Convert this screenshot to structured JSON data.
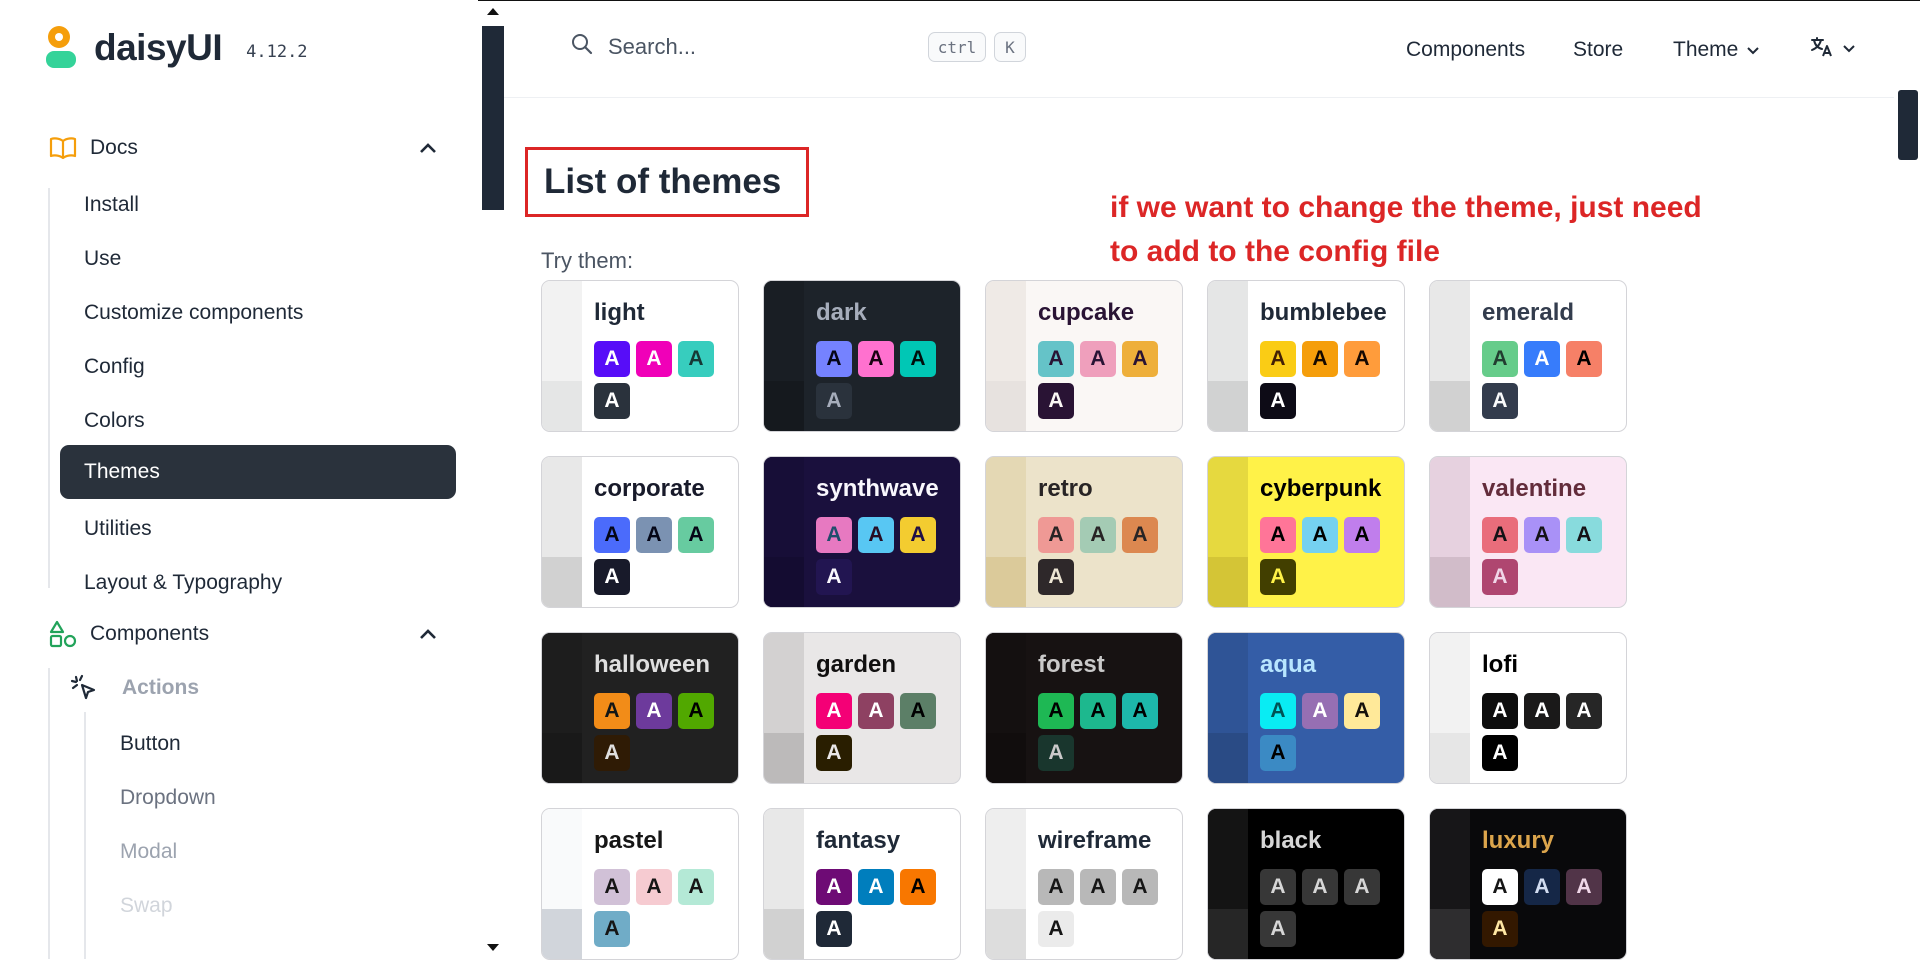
{
  "brand": {
    "name": "daisyUI",
    "version": "4.12.2"
  },
  "search": {
    "placeholder": "Search...",
    "kbd1": "ctrl",
    "kbd2": "K"
  },
  "topnav": {
    "components": "Components",
    "store": "Store",
    "theme": "Theme"
  },
  "sidebar": {
    "docs_label": "Docs",
    "docs_items": [
      "Install",
      "Use",
      "Customize components",
      "Config",
      "Colors",
      "Themes",
      "Utilities",
      "Layout & Typography"
    ],
    "active_item": "Themes",
    "components_label": "Components",
    "actions_label": "Actions",
    "actions_items": [
      "Button",
      "Dropdown",
      "Modal",
      "Swap"
    ]
  },
  "main": {
    "title": "List of themes",
    "annotation": "if we want to change the theme, just need to add to the config file",
    "try_label": "Try them:",
    "swatch_letter": "A",
    "themes": [
      {
        "name": "light",
        "bg": "#ffffff",
        "side": "#f2f2f2",
        "side2": "#e5e6e6",
        "text": "#1f2937",
        "sw": [
          [
            "#570df8",
            "#ffffff"
          ],
          [
            "#f000b8",
            "#ffffff"
          ],
          [
            "#37cdbe",
            "#163835"
          ],
          [
            "#2a323c",
            "#ffffff"
          ]
        ]
      },
      {
        "name": "dark",
        "bg": "#1d232a",
        "side": "#191e24",
        "side2": "#15191e",
        "text": "#a6adbb",
        "sw": [
          [
            "#7582ff",
            "#050617"
          ],
          [
            "#ff71cf",
            "#190211"
          ],
          [
            "#00c7b5",
            "#000e0c"
          ],
          [
            "#2a323c",
            "#a6adbb"
          ]
        ]
      },
      {
        "name": "cupcake",
        "bg": "#faf7f5",
        "side": "#efeae6",
        "side2": "#e7e2df",
        "text": "#291334",
        "sw": [
          [
            "#65c3c8",
            "#291334"
          ],
          [
            "#ef9fbc",
            "#291334"
          ],
          [
            "#eeaf3a",
            "#291334"
          ],
          [
            "#291334",
            "#faf7f5"
          ]
        ]
      },
      {
        "name": "bumblebee",
        "bg": "#ffffff",
        "side": "#e5e6e6",
        "side2": "#d1d2d2",
        "text": "#1f2937",
        "sw": [
          [
            "#facc15",
            "#422006"
          ],
          [
            "#f59e0b",
            "#150a00"
          ],
          [
            "#ff9c3b",
            "#160902"
          ],
          [
            "#0d0b16",
            "#ffffff"
          ]
        ]
      },
      {
        "name": "emerald",
        "bg": "#ffffff",
        "side": "#e8e8e8",
        "side2": "#d1d1d1",
        "text": "#333c4d",
        "sw": [
          [
            "#66cc8a",
            "#223d30"
          ],
          [
            "#377cfb",
            "#ffffff"
          ],
          [
            "#f68067",
            "#000000"
          ],
          [
            "#333c4d",
            "#f9fafb"
          ]
        ]
      },
      {
        "name": "corporate",
        "bg": "#ffffff",
        "side": "#e8e8e8",
        "side2": "#d1d1d1",
        "text": "#181a2a",
        "sw": [
          [
            "#4b6bfb",
            "#050617"
          ],
          [
            "#7b92b2",
            "#050617"
          ],
          [
            "#67cba0",
            "#050617"
          ],
          [
            "#181a2a",
            "#ffffff"
          ]
        ]
      },
      {
        "name": "synthwave",
        "bg": "#1a103d",
        "side": "#170e37",
        "side2": "#140c31",
        "text": "#f9f7fd",
        "sw": [
          [
            "#e779c1",
            "#204e6c"
          ],
          [
            "#58c7f3",
            "#270d24"
          ],
          [
            "#f3cc30",
            "#201047"
          ],
          [
            "#221551",
            "#f9f7fd"
          ]
        ]
      },
      {
        "name": "retro",
        "bg": "#ece3ca",
        "side": "#e4d8b4",
        "side2": "#dbca9a",
        "text": "#282425",
        "sw": [
          [
            "#ef9995",
            "#282425"
          ],
          [
            "#a4cbb4",
            "#282425"
          ],
          [
            "#dc8850",
            "#282425"
          ],
          [
            "#2e282a",
            "#ede6d4"
          ]
        ]
      },
      {
        "name": "cyberpunk",
        "bg": "#fff248",
        "side": "#e6d93f",
        "side2": "#d4c536",
        "text": "#000000",
        "sw": [
          [
            "#ff7598",
            "#000000"
          ],
          [
            "#75d1f0",
            "#000000"
          ],
          [
            "#c07eec",
            "#000000"
          ],
          [
            "#423f00",
            "#fff248"
          ]
        ]
      },
      {
        "name": "valentine",
        "bg": "#fae7f4",
        "side": "#e6d1df",
        "side2": "#d1bcc9",
        "text": "#632c3b",
        "sw": [
          [
            "#e96d7b",
            "#151216"
          ],
          [
            "#a991f7",
            "#151216"
          ],
          [
            "#88dbdd",
            "#151216"
          ],
          [
            "#af4670",
            "#f0d6e8"
          ]
        ]
      },
      {
        "name": "halloween",
        "bg": "#212121",
        "side": "#1d1d1d",
        "side2": "#191919",
        "text": "#dfdfdf",
        "sw": [
          [
            "#f28c18",
            "#131616"
          ],
          [
            "#6d3a9c",
            "#ffffff"
          ],
          [
            "#51a800",
            "#000000"
          ],
          [
            "#2f1b05",
            "#dfdfdf"
          ]
        ]
      },
      {
        "name": "garden",
        "bg": "#e9e7e7",
        "side": "#d3d1d1",
        "side2": "#bcbaba",
        "text": "#100f0f",
        "sw": [
          [
            "#f40076",
            "#ffffff"
          ],
          [
            "#8e4162",
            "#ffffff"
          ],
          [
            "#5c7f67",
            "#000000"
          ],
          [
            "#291e00",
            "#e9e7e7"
          ]
        ]
      },
      {
        "name": "forest",
        "bg": "#171212",
        "side": "#141010",
        "side2": "#110d0d",
        "text": "#cac9c9",
        "sw": [
          [
            "#1eb854",
            "#000000"
          ],
          [
            "#1db88e",
            "#000000"
          ],
          [
            "#1db8ab",
            "#000000"
          ],
          [
            "#19362d",
            "#cac9c9"
          ]
        ]
      },
      {
        "name": "aqua",
        "bg": "#345da7",
        "side": "#2f5496",
        "side2": "#2a4b85",
        "text": "#b8e6ff",
        "sw": [
          [
            "#09ecf3",
            "#005355"
          ],
          [
            "#966fb3",
            "#ffffff"
          ],
          [
            "#ffe999",
            "#16120c"
          ],
          [
            "#3b8ac4",
            "#000000"
          ]
        ]
      },
      {
        "name": "lofi",
        "bg": "#ffffff",
        "side": "#f2f2f2",
        "side2": "#e6e6e6",
        "text": "#000000",
        "sw": [
          [
            "#0d0d0d",
            "#ffffff"
          ],
          [
            "#1a1919",
            "#ffffff"
          ],
          [
            "#262626",
            "#ffffff"
          ],
          [
            "#000000",
            "#ffffff"
          ]
        ]
      },
      {
        "name": "pastel",
        "bg": "#ffffff",
        "side": "#f9fafb",
        "side2": "#d1d5db",
        "text": "#161616",
        "sw": [
          [
            "#d1c1d7",
            "#161616"
          ],
          [
            "#f6cbd1",
            "#161616"
          ],
          [
            "#b4e9d6",
            "#161616"
          ],
          [
            "#70acc7",
            "#161616"
          ]
        ]
      },
      {
        "name": "fantasy",
        "bg": "#ffffff",
        "side": "#e8e8e8",
        "side2": "#d1d1d1",
        "text": "#1f2937",
        "sw": [
          [
            "#6e0b75",
            "#ffffff"
          ],
          [
            "#007ebd",
            "#ffffff"
          ],
          [
            "#f87700",
            "#000000"
          ],
          [
            "#1f2937",
            "#ffffff"
          ]
        ]
      },
      {
        "name": "wireframe",
        "bg": "#ffffff",
        "side": "#eeeeee",
        "side2": "#dddddd",
        "text": "#1f2937",
        "sw": [
          [
            "#b8b8b8",
            "#161616"
          ],
          [
            "#b8b8b8",
            "#161616"
          ],
          [
            "#b8b8b8",
            "#161616"
          ],
          [
            "#ebebeb",
            "#161616"
          ]
        ]
      },
      {
        "name": "black",
        "bg": "#000000",
        "side": "#141414",
        "side2": "#262626",
        "text": "#d6d6d6",
        "sw": [
          [
            "#373737",
            "#d6d6d6"
          ],
          [
            "#373737",
            "#d6d6d6"
          ],
          [
            "#373737",
            "#d6d6d6"
          ],
          [
            "#373737",
            "#d6d6d6"
          ]
        ]
      },
      {
        "name": "luxury",
        "bg": "#09090b",
        "side": "#171618",
        "side2": "#2e2d2f",
        "text": "#dca54c",
        "sw": [
          [
            "#ffffff",
            "#161616"
          ],
          [
            "#152747",
            "#d1dcf0"
          ],
          [
            "#513448",
            "#f0d7e8"
          ],
          [
            "#331800",
            "#ffe7a3"
          ]
        ]
      }
    ]
  }
}
